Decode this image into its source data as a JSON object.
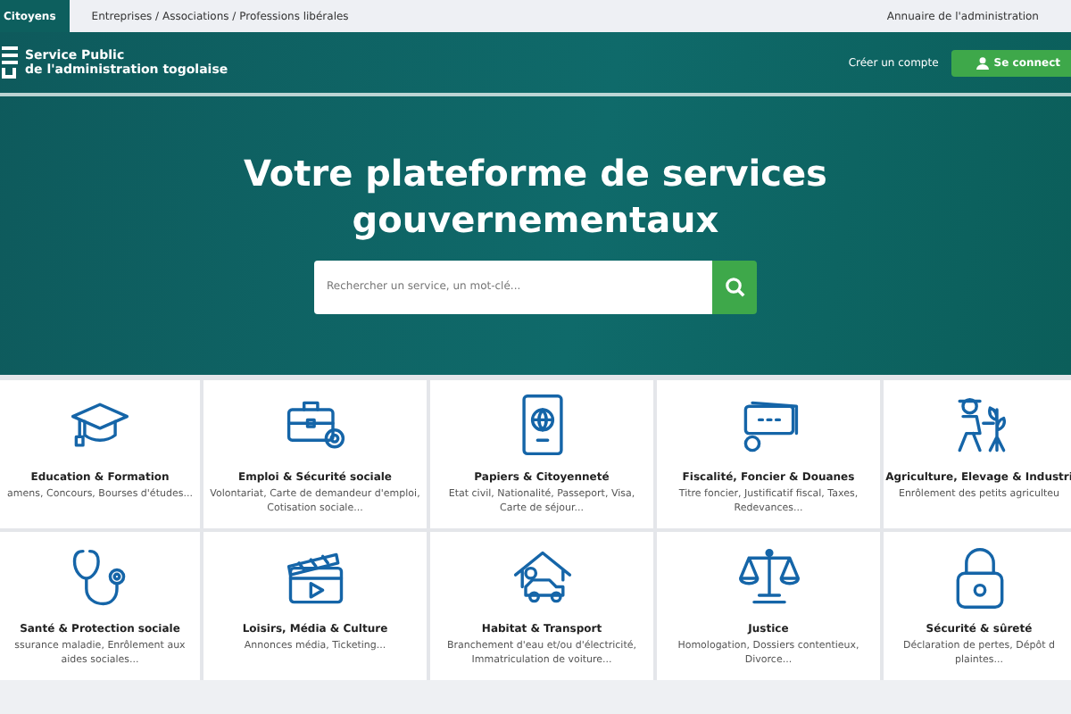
{
  "top_tabs": [
    {
      "label": "Citoyens",
      "selected": true
    },
    {
      "label": "Entreprises / Associations / Professions libérales",
      "selected": false
    }
  ],
  "top_link": "Annuaire de l'administration",
  "header": {
    "title_line_1": "Service Public",
    "title_line_2": "de l'administration togolaise",
    "register_link": "Créer un compte",
    "login_button": "Se connect"
  },
  "hero": {
    "title": "Votre plateforme de services gouvernementaux",
    "search": {
      "placeholder": "Rechercher un service, un mot-clé..."
    }
  },
  "categories": [
    {
      "kind": "graduation",
      "title": "Education & Formation",
      "description": "amens, Concours, Bourses d'études..."
    },
    {
      "kind": "briefcase",
      "title": "Emploi & Sécurité sociale",
      "description": "Volontariat, Carte de demandeur d'emploi, Cotisation sociale..."
    },
    {
      "kind": "passport",
      "title": "Papiers & Citoyenneté",
      "description": "Etat civil, Nationalité, Passeport, Visa, Carte de séjour..."
    },
    {
      "kind": "money",
      "title": "Fiscalité, Foncier & Douanes",
      "description": "Titre foncier, Justificatif fiscal, Taxes, Redevances..."
    },
    {
      "kind": "farmer",
      "title": "Agriculture, Elevage & Industri",
      "description": "Enrôlement des petits agriculteu"
    },
    {
      "kind": "stethoscope",
      "title": "Santé & Protection sociale",
      "description": "ssurance maladie, Enrôlement aux aides sociales..."
    },
    {
      "kind": "clapper",
      "title": "Loisirs, Média & Culture",
      "description": "Annonces média, Ticketing..."
    },
    {
      "kind": "house",
      "title": "Habitat & Transport",
      "description": "Branchement d'eau et/ou d'électricité, Immatriculation de voiture..."
    },
    {
      "kind": "scales",
      "title": "Justice",
      "description": "Homologation, Dossiers contentieux, Divorce..."
    },
    {
      "kind": "lock",
      "title": "Sécurité & sûreté",
      "description": "Déclaration de pertes, Dépôt d plaintes..."
    }
  ]
}
